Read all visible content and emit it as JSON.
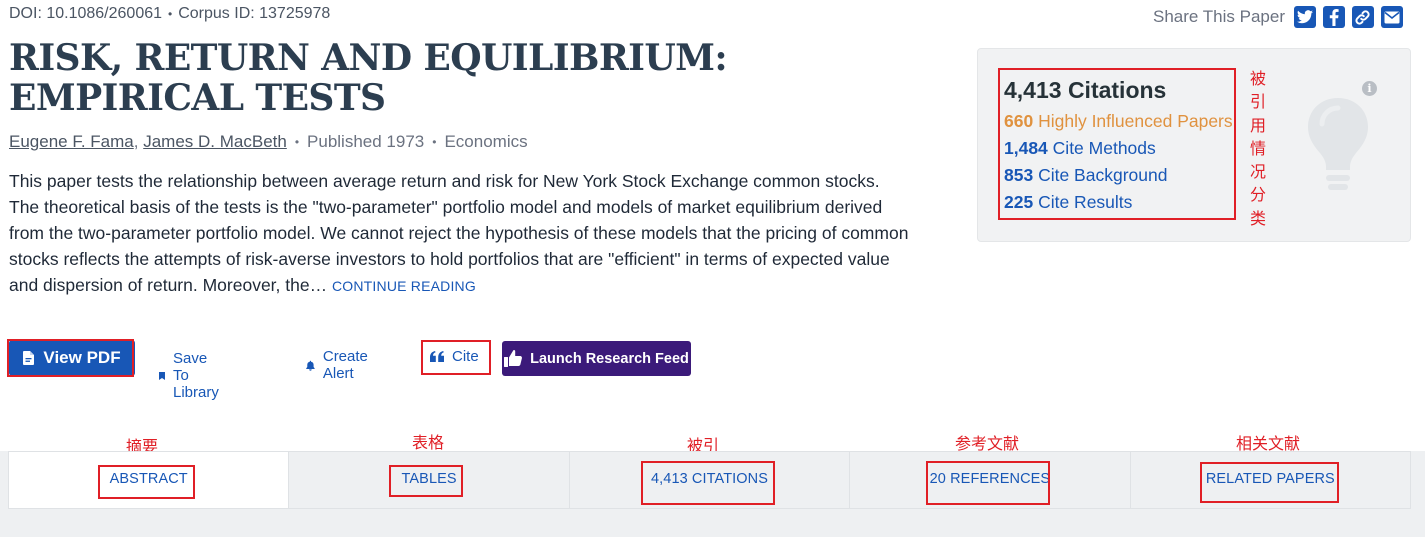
{
  "meta": {
    "doi": "DOI: 10.1086/260061",
    "corpus": "Corpus ID: 13725978"
  },
  "share": {
    "label": "Share This Paper",
    "icons": [
      "twitter-icon",
      "facebook-icon",
      "link-icon",
      "email-icon"
    ]
  },
  "paper": {
    "title": "RISK, RETURN AND EQUILIBRIUM: EMPIRICAL TESTS",
    "authors": [
      "Eugene F. Fama",
      "James D. MacBeth"
    ],
    "author_separator": ",",
    "published": "Published 1973",
    "field": "Economics",
    "abstract": "This paper tests the relationship between average return and risk for New York Stock Exchange common stocks. The theoretical basis of the tests is the \"two-parameter\" portfolio model and models of market equilibrium derived from the two-parameter portfolio model. We cannot reject the hypothesis of these models that the pricing of common stocks reflects the attempts of risk-averse investors to hold portfolios that are \"efficient\" in terms of expected value and dispersion of return. Moreover, the…",
    "continue_reading": "CONTINUE READING"
  },
  "actions": {
    "view_pdf": "View PDF",
    "save": "Save To Library",
    "alert": "Create Alert",
    "cite": "Cite",
    "feed": "Launch Research Feed"
  },
  "citations": {
    "total": "4,413 Citations",
    "highly_influenced": {
      "count": "660",
      "label": "Highly Influenced Papers"
    },
    "methods": {
      "count": "1,484",
      "label": "Cite Methods"
    },
    "background": {
      "count": "853",
      "label": "Cite Background"
    },
    "results": {
      "count": "225",
      "label": "Cite Results"
    },
    "info_glyph": "i"
  },
  "annotations": {
    "citation_breakdown": "被引用情况分类",
    "abstract": "摘要",
    "tables": "表格",
    "citations": "被引",
    "references": "参考文献",
    "related": "相关文献"
  },
  "tabs": [
    {
      "label": "ABSTRACT"
    },
    {
      "label": "TABLES"
    },
    {
      "label": "4,413 CITATIONS"
    },
    {
      "label": "20 REFERENCES"
    },
    {
      "label": "RELATED PAPERS"
    }
  ],
  "colors": {
    "accent": "#1857b6",
    "highlight_orange": "#e0923f",
    "annotation_red": "#e01f26",
    "feed_purple": "#3b1a7a"
  }
}
